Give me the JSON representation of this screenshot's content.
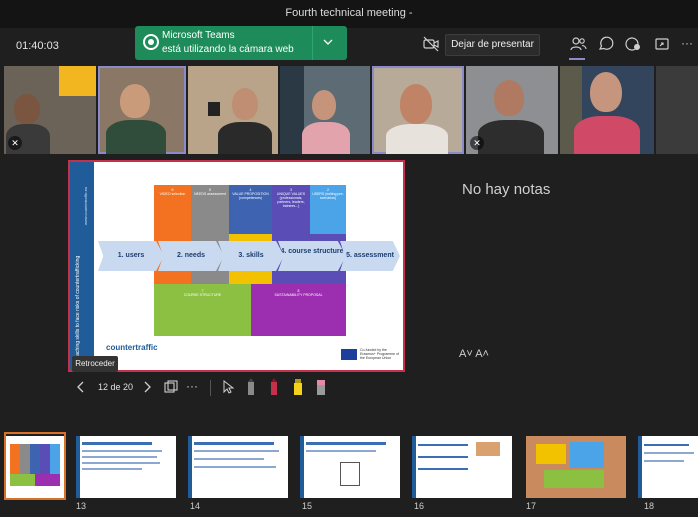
{
  "window": {
    "title": "Fourth technical meeting -"
  },
  "top_bar": {
    "elapsed": "01:40:03",
    "notification": {
      "line1": "Microsoft Teams",
      "line2": "está utilizando la cámara web"
    },
    "stop_presenting": "Dejar de presentar",
    "more": "···"
  },
  "slide": {
    "side_text": "Teaching skills to face risks of countertrafficking",
    "url": "www.countertraffic.eu",
    "steps": [
      {
        "label": "1. users"
      },
      {
        "label": "2. needs"
      },
      {
        "label": "3. skills"
      },
      {
        "label": "4. course structure"
      },
      {
        "label": "5. assessment"
      }
    ],
    "top_blocks": [
      {
        "num": "6",
        "text": "VIDEO selection"
      },
      {
        "num": "5",
        "text": "NEEDS assessment"
      },
      {
        "num": "4",
        "text": "VALUE PROPOSITION (competences)"
      },
      {
        "num": "3",
        "text": "UNIQUE VALUES (professionals, partners, leaders, trainees...)"
      },
      {
        "num": "2",
        "text": "USERS (writing pre-scenarios)"
      }
    ],
    "bottom_blocks": [
      {
        "num": "7",
        "text": "COURSE STRUCTURE"
      },
      {
        "num": "8",
        "text": "SUSTAINABILITY PROPOSAL"
      }
    ],
    "logo": "countertraffic",
    "eu_caption": "Co-funded by the Erasmus+ Programme of the European Union",
    "colors": {
      "orange": "#f37221",
      "grey": "#8a8a8a",
      "blue": "#3d63b1",
      "indigo": "#5a4eb6",
      "lightblue": "#4ca4e8",
      "green": "#8cc043",
      "purple": "#9c2fb0",
      "yellow": "#f2c200",
      "arrow": "#c9daf0"
    }
  },
  "retroceder": "Retroceder",
  "notes": {
    "empty": "No hay notas",
    "font_controls": "A˅  A˄"
  },
  "controls": {
    "page": "12 de 20",
    "more": "···"
  },
  "thumbnails": [
    {
      "num": "13"
    },
    {
      "num": "14"
    },
    {
      "num": "15"
    },
    {
      "num": "16"
    },
    {
      "num": "17"
    },
    {
      "num": "18"
    }
  ],
  "icons": [
    "camera-icon",
    "chevron-down-icon",
    "camera-off-icon",
    "people-icon",
    "chat-icon",
    "apps-icon",
    "share-icon",
    "more-icon",
    "mic-off-icon",
    "prev-icon",
    "next-icon",
    "slides-icon",
    "pointer-icon",
    "pen-red-icon",
    "highlighter-icon",
    "eraser-icon"
  ]
}
